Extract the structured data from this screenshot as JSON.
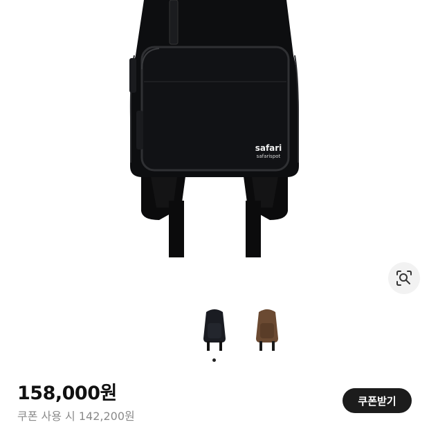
{
  "product": {
    "brand_main": "safari",
    "brand_sub": "safarispot",
    "price": "158,000원",
    "coupon_price": "쿠폰 사용 시 142,200원"
  },
  "actions": {
    "coupon_button_label": "쿠폰받기"
  },
  "icons": {
    "lens": "image-search-icon"
  },
  "variants": [
    {
      "color_name": "black",
      "color": "#1a1c22",
      "selected": true
    },
    {
      "color_name": "brown",
      "color": "#6b4a32",
      "selected": false
    }
  ]
}
